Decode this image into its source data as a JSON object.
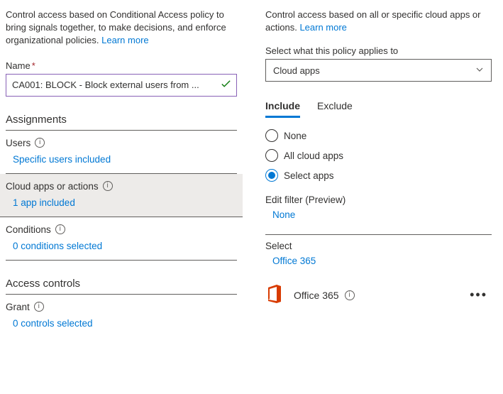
{
  "left": {
    "intro": "Control access based on Conditional Access policy to bring signals together, to make decisions, and enforce organizational policies.",
    "learn_more": "Learn more",
    "name_label": "Name",
    "name_value": "CA001: BLOCK - Block external users from ...",
    "assignments_title": "Assignments",
    "users": {
      "label": "Users",
      "value": "Specific users included"
    },
    "cloud_apps": {
      "label": "Cloud apps or actions",
      "value": "1 app included"
    },
    "conditions": {
      "label": "Conditions",
      "value": "0 conditions selected"
    },
    "access_controls_title": "Access controls",
    "grant": {
      "label": "Grant",
      "value": "0 controls selected"
    }
  },
  "right": {
    "intro": "Control access based on all or specific cloud apps or actions.",
    "learn_more": "Learn more",
    "applies_label": "Select what this policy applies to",
    "applies_value": "Cloud apps",
    "tabs": {
      "include": "Include",
      "exclude": "Exclude"
    },
    "radios": {
      "none": "None",
      "all": "All cloud apps",
      "select": "Select apps"
    },
    "edit_filter_label": "Edit filter (Preview)",
    "edit_filter_value": "None",
    "select_label": "Select",
    "select_value": "Office 365",
    "app_name": "Office 365"
  }
}
